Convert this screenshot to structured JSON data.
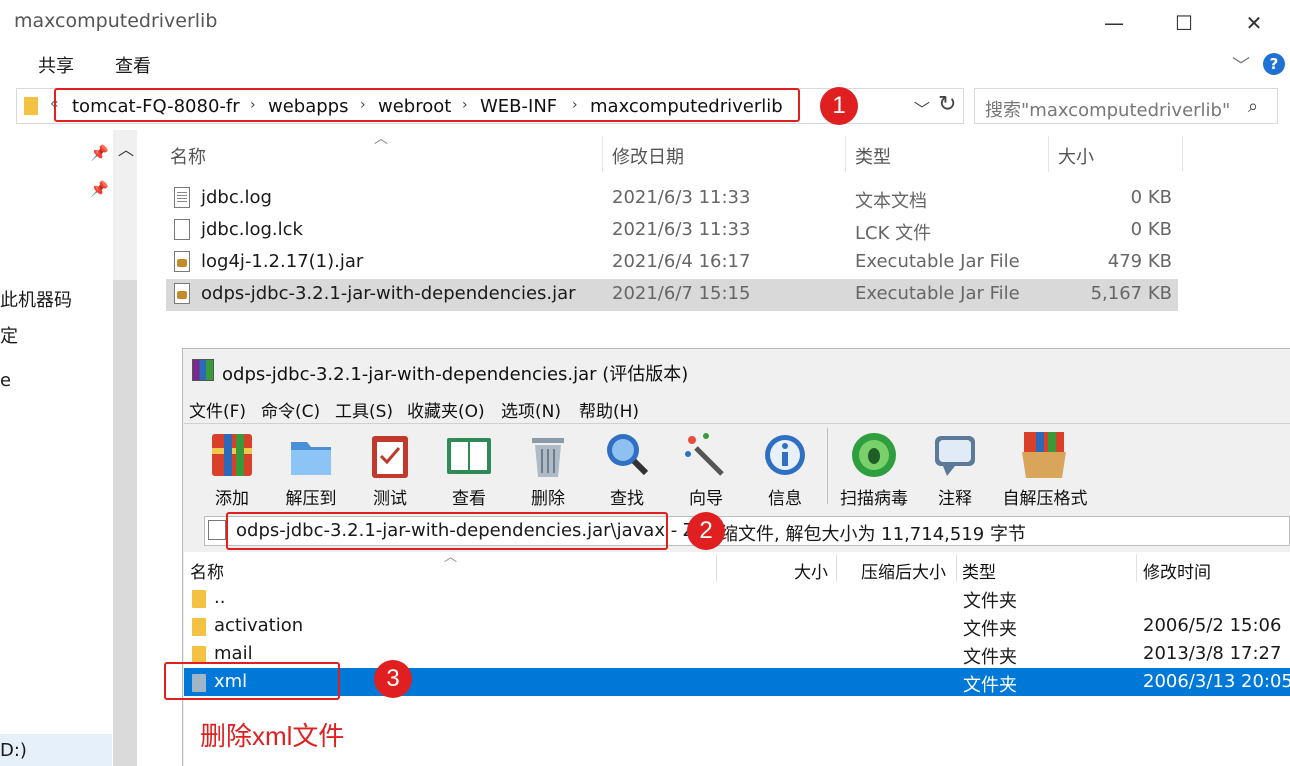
{
  "explorer": {
    "title": "maxcomputedriverlib",
    "controls": {
      "minimize": "—",
      "maximize": "☐",
      "close": "✕"
    },
    "ribbon_tabs": [
      "共享",
      "查看"
    ],
    "breadcrumb": [
      "tomcat-FQ-8080-fr",
      "webapps",
      "webroot",
      "WEB-INF",
      "maxcomputedriverlib"
    ],
    "search_placeholder": "搜索\"maxcomputedriverlib\"",
    "columns": {
      "name": "名称",
      "date": "修改日期",
      "type": "类型",
      "size": "大小"
    },
    "files": [
      {
        "name": "jdbc.log",
        "date": "2021/6/3 11:33",
        "type": "文本文档",
        "size": "0 KB",
        "icon": "text-file-icon"
      },
      {
        "name": "jdbc.log.lck",
        "date": "2021/6/3 11:33",
        "type": "LCK 文件",
        "size": "0 KB",
        "icon": "file-icon"
      },
      {
        "name": "log4j-1.2.17(1).jar",
        "date": "2021/6/4 16:17",
        "type": "Executable Jar File",
        "size": "479 KB",
        "icon": "jar-file-icon"
      },
      {
        "name": "odps-jdbc-3.2.1-jar-with-dependencies.jar",
        "date": "2021/6/7 15:15",
        "type": "Executable Jar File",
        "size": "5,167 KB",
        "icon": "jar-file-icon"
      }
    ],
    "nav_fragments": [
      "此机器码",
      "定",
      "e",
      "D:)"
    ]
  },
  "winrar": {
    "title": "odps-jdbc-3.2.1-jar-with-dependencies.jar (评估版本)",
    "menu": [
      "文件(F)",
      "命令(C)",
      "工具(S)",
      "收藏夹(O)",
      "选项(N)",
      "帮助(H)"
    ],
    "tools": [
      {
        "label": "添加",
        "icon": "add-archive-icon",
        "color": "#d8402a"
      },
      {
        "label": "解压到",
        "icon": "extract-folder-icon",
        "color": "#4a90d9"
      },
      {
        "label": "测试",
        "icon": "test-clipboard-icon",
        "color": "#c0392b"
      },
      {
        "label": "查看",
        "icon": "view-book-icon",
        "color": "#2e8b57"
      },
      {
        "label": "删除",
        "icon": "trash-can-icon",
        "color": "#8a9aa8"
      },
      {
        "label": "查找",
        "icon": "magnifier-icon",
        "color": "#2f6fc4"
      },
      {
        "label": "向导",
        "icon": "wizard-wand-icon",
        "color": "#555"
      },
      {
        "label": "信息",
        "icon": "info-icon",
        "color": "#2f6fc4"
      },
      {
        "label": "扫描病毒",
        "icon": "virus-scan-icon",
        "color": "#2e9e3e"
      },
      {
        "label": "注释",
        "icon": "comment-icon",
        "color": "#5b7a9a"
      },
      {
        "label": "自解压格式",
        "icon": "sfx-box-icon",
        "color": "#c58a2a"
      }
    ],
    "path_text": "odps-jdbc-3.2.1-jar-with-dependencies.jar\\javax - ZI",
    "path_suffix": "缩文件, 解包大小为 11,714,519 字节",
    "columns": {
      "name": "名称",
      "size": "大小",
      "packed": "压缩后大小",
      "type": "类型",
      "modified": "修改时间"
    },
    "rows": [
      {
        "name": "..",
        "type": "文件夹",
        "modified": ""
      },
      {
        "name": "activation",
        "type": "文件夹",
        "modified": "2006/5/2 15:06"
      },
      {
        "name": "mail",
        "type": "文件夹",
        "modified": "2013/3/8 17:27"
      },
      {
        "name": "xml",
        "type": "文件夹",
        "modified": "2006/3/13 20:05"
      }
    ]
  },
  "annotations": {
    "badges": [
      "1",
      "2",
      "3"
    ],
    "note": "删除xml文件",
    "color": "#e02020"
  }
}
